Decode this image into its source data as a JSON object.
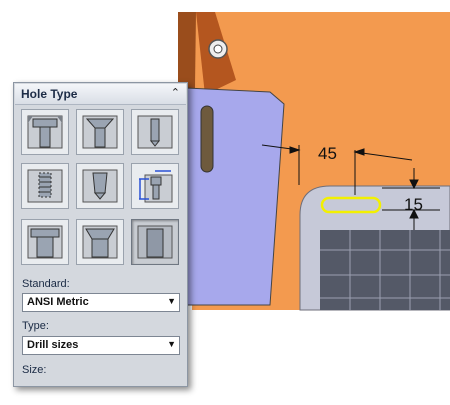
{
  "panel": {
    "title": "Hole Type",
    "collapse_icon": "double-chevron-up-icon",
    "hole_types": [
      {
        "name": "counterbore-hole-icon",
        "selected": false
      },
      {
        "name": "countersink-hole-icon",
        "selected": false
      },
      {
        "name": "simple-hole-icon",
        "selected": false
      },
      {
        "name": "tapped-hole-icon",
        "selected": false
      },
      {
        "name": "tapered-pipe-tap-hole-icon",
        "selected": false
      },
      {
        "name": "legacy-hole-icon",
        "selected": false
      },
      {
        "name": "counterbore-slot-icon",
        "selected": false
      },
      {
        "name": "countersink-slot-icon",
        "selected": false
      },
      {
        "name": "slot-icon",
        "selected": true
      }
    ],
    "standard_label": "Standard:",
    "standard_value": "ANSI Metric",
    "type_label": "Type:",
    "type_value": "Drill sizes",
    "size_label": "Size:"
  },
  "viewport": {
    "dimension_horizontal": "45",
    "dimension_vertical": "15"
  },
  "colors": {
    "plate_orange": "#f39a4f",
    "plate_blue": "#a7a8ec",
    "slot_highlight": "#f2f000",
    "panel_bg": "#d4d8de"
  }
}
